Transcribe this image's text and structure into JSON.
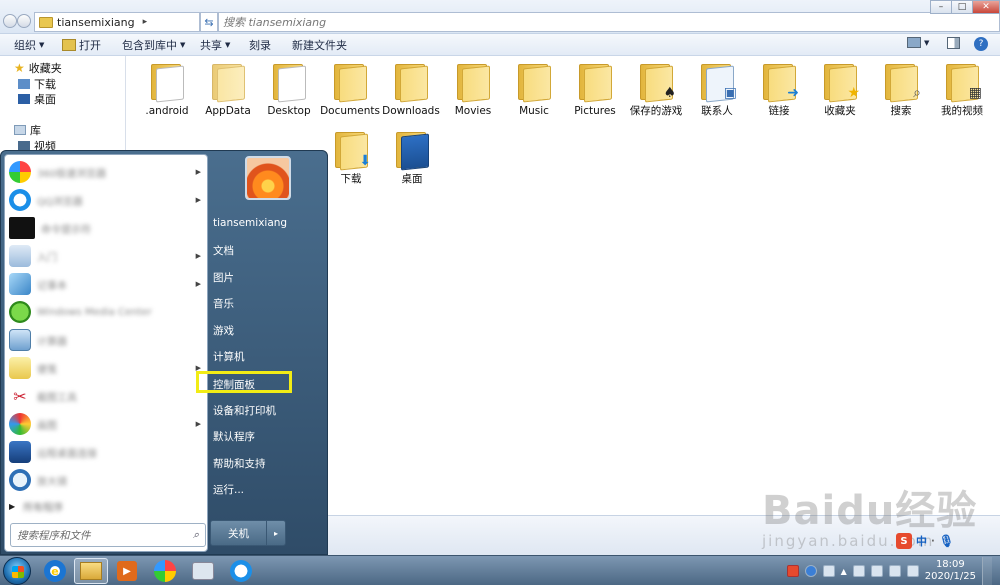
{
  "address": {
    "path": "tiansemixiang",
    "search_placeholder": "搜索 tiansemixiang"
  },
  "toolbar": {
    "organize": "组织",
    "open": "打开",
    "include_in_library": "包含到库中",
    "share": "共享",
    "burn": "刻录",
    "new_folder": "新建文件夹"
  },
  "nav": {
    "favorites": "收藏夹",
    "download": "下载",
    "desktop": "桌面",
    "libraries": "库",
    "videos": "视频"
  },
  "folders": [
    {
      "label": ".android",
      "icon": "document-icon"
    },
    {
      "label": "AppData",
      "icon": "hidden-folder-icon"
    },
    {
      "label": "Desktop",
      "icon": "document-icon"
    },
    {
      "label": "Documents",
      "icon": "folder-icon"
    },
    {
      "label": "Downloads",
      "icon": "folder-icon"
    },
    {
      "label": "Movies",
      "icon": "folder-icon"
    },
    {
      "label": "Music",
      "icon": "folder-icon"
    },
    {
      "label": "Pictures",
      "icon": "folder-icon"
    },
    {
      "label": "保存的游戏",
      "icon": "spade-icon"
    },
    {
      "label": "联系人",
      "icon": "contact-card-icon"
    },
    {
      "label": "链接",
      "icon": "arrow-icon"
    },
    {
      "label": "收藏夹",
      "icon": "star-icon"
    },
    {
      "label": "搜索",
      "icon": "magnifier-icon"
    },
    {
      "label": "我的视频",
      "icon": "film-icon"
    },
    {
      "label": "下载",
      "icon": "download-arrow-icon"
    },
    {
      "label": "桌面",
      "icon": "desktop-icon"
    }
  ],
  "start_menu": {
    "username": "tiansemixiang",
    "programs": [
      {
        "label": "360极速浏览器",
        "icon": "color-wheel-icon"
      },
      {
        "label": "QQ浏览器",
        "icon": "browser-icon"
      },
      {
        "label": "命令提示符",
        "icon": "terminal-icon"
      },
      {
        "label": "入门",
        "icon": "getting-started-icon"
      },
      {
        "label": "记事本",
        "icon": "notepad-icon"
      },
      {
        "label": "Windows Media Center",
        "icon": "windows-flag-icon"
      },
      {
        "label": "计算器",
        "icon": "calculator-icon"
      },
      {
        "label": "便笺",
        "icon": "sticky-note-icon"
      },
      {
        "label": "截图工具",
        "icon": "scissors-icon"
      },
      {
        "label": "画图",
        "icon": "paint-icon"
      },
      {
        "label": "远程桌面连接",
        "icon": "remote-desktop-icon"
      },
      {
        "label": "放大镜",
        "icon": "magnifier-icon"
      }
    ],
    "all_programs": "所有程序",
    "search_placeholder": "搜索程序和文件",
    "right_items": [
      "文档",
      "图片",
      "音乐",
      "游戏",
      "计算机",
      "控制面板",
      "设备和打印机",
      "默认程序",
      "帮助和支持",
      "运行..."
    ],
    "shutdown": "关机"
  },
  "tray": {
    "ime_lang": "中",
    "time": "18:09",
    "date": "2020/1/25"
  },
  "watermark": {
    "brand": "Baidu经验",
    "site": "jingyan.baidu.com"
  },
  "colors": {
    "highlight": "#f2ec15",
    "start_menu_bg": "#3b5a78",
    "taskbar": "#5a7693"
  }
}
